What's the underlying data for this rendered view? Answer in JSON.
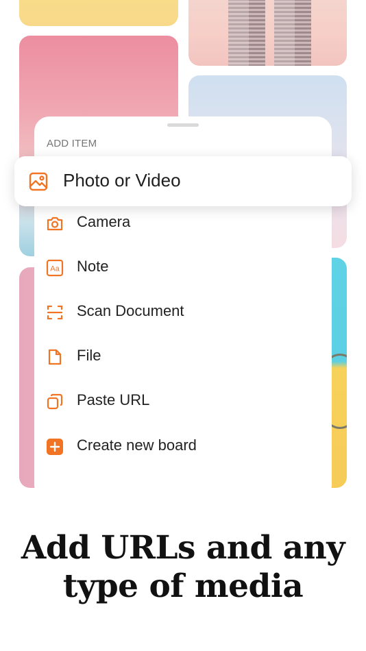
{
  "sheet": {
    "title": "ADD ITEM",
    "accent_color": "#f07424"
  },
  "menu": {
    "highlighted": {
      "label": "Photo or Video",
      "icon": "photo-icon"
    },
    "items": [
      {
        "label": "Camera",
        "icon": "camera-icon"
      },
      {
        "label": "Note",
        "icon": "note-icon"
      },
      {
        "label": "Scan Document",
        "icon": "scan-icon"
      },
      {
        "label": "File",
        "icon": "file-icon"
      },
      {
        "label": "Paste URL",
        "icon": "paste-url-icon"
      },
      {
        "label": "Create new board",
        "icon": "plus-board-icon"
      }
    ]
  },
  "headline": {
    "line1": "Add URLs and any",
    "line2": "type of media"
  }
}
